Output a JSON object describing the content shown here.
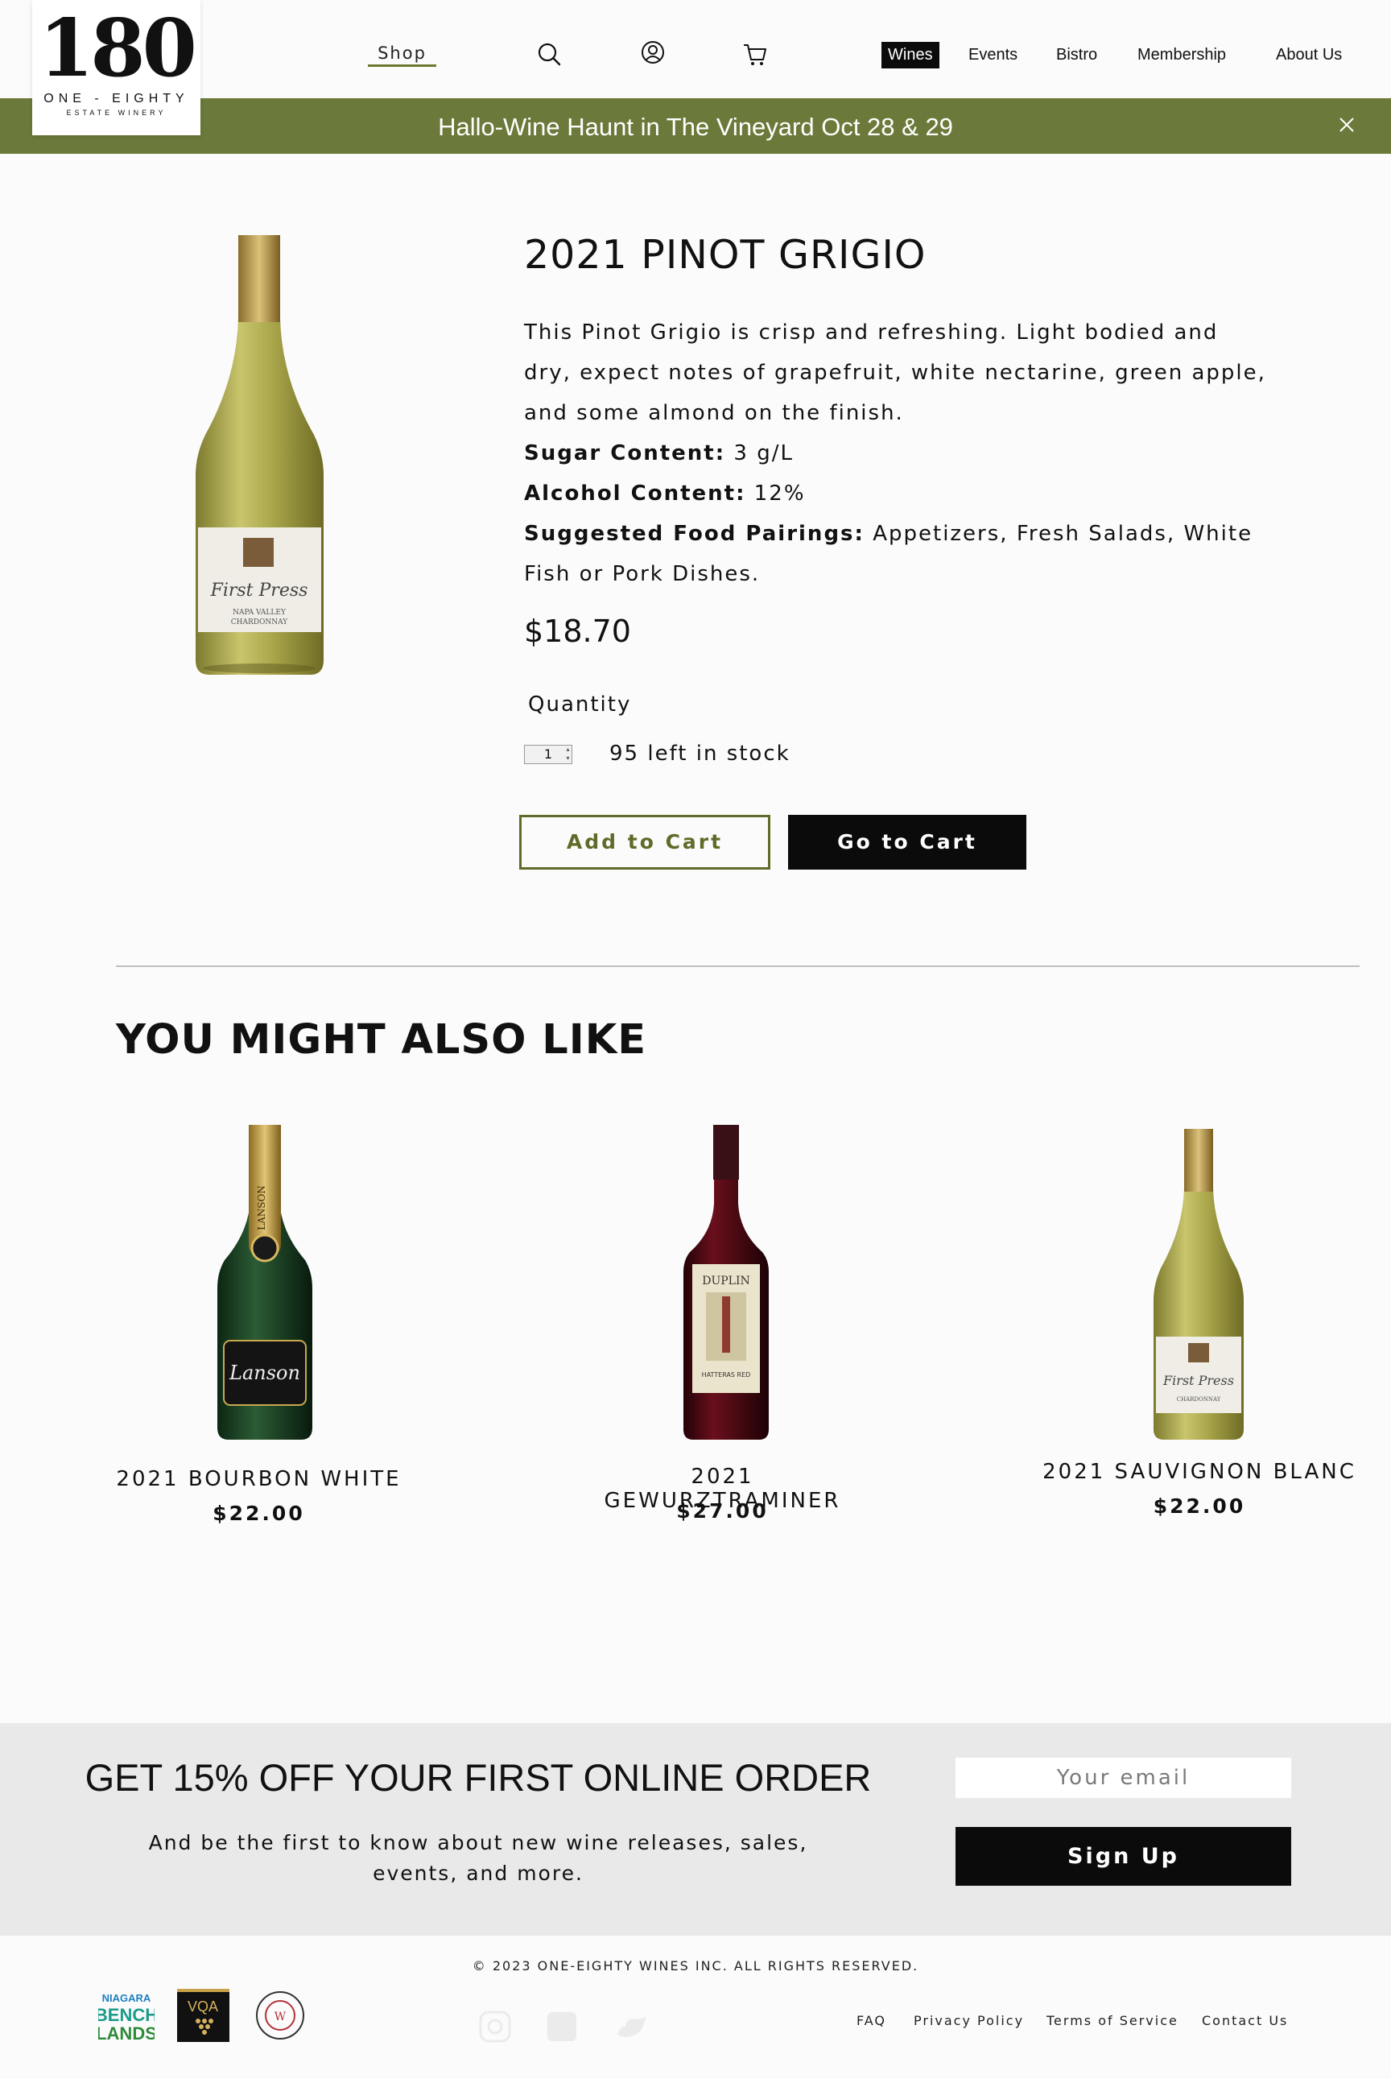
{
  "logo": {
    "number": "180",
    "name": "ONE - EIGHTY",
    "sub": "ESTATE WINERY"
  },
  "nav": {
    "shop": "Shop",
    "icons": [
      "search-icon",
      "account-icon",
      "cart-icon"
    ],
    "wines": "Wines",
    "events": "Events",
    "bistro": "Bistro",
    "membership": "Membership",
    "about": "About Us",
    "accent_color": "#6b7a2e"
  },
  "banner": {
    "text": "Hallo-Wine Haunt in The Vineyard Oct 28 & 29",
    "background": "#6b7a3a"
  },
  "product": {
    "title": "2021 PINOT GRIGIO",
    "description": "This Pinot Grigio is crisp and refreshing. Light bodied and dry, expect notes of grapefruit, white nectarine, green apple, and some almond on the finish.",
    "sugar_label": "Sugar Content:",
    "sugar_value": "3 g/L",
    "alcohol_label": "Alcohol Content:",
    "alcohol_value": "12%",
    "pairings_label": "Suggested Food Pairings:",
    "pairings_value": "Appetizers, Fresh Salads, White Fish or Pork Dishes.",
    "price": "$18.70",
    "quantity_label": "Quantity",
    "quantity_value": "1",
    "stock": "95 left in stock",
    "add_to_cart": "Add to Cart",
    "go_to_cart": "Go to Cart"
  },
  "recommendations": {
    "title": "YOU MIGHT ALSO LIKE",
    "items": [
      {
        "name": "2021 BOURBON WHITE",
        "price": "$22.00"
      },
      {
        "name": "2021 GEWURZTRAMINER",
        "price": "$27.00"
      },
      {
        "name": "2021 SAUVIGNON BLANC",
        "price": "$22.00"
      }
    ]
  },
  "newsletter": {
    "title": "GET 15% OFF YOUR FIRST ONLINE ORDER",
    "subtitle": "And be the first to know about new wine releases, sales, events, and more.",
    "email_placeholder": "Your email",
    "signup": "Sign Up"
  },
  "footer": {
    "copyright": "© 2023 ONE-EIGHTY WINES INC. ALL RIGHTS RESERVED.",
    "logos": [
      "NIAGARA BENCH LANDS",
      "VQA",
      "W"
    ],
    "links": [
      "FAQ",
      "Privacy Policy",
      "Terms of Service",
      "Contact Us"
    ]
  }
}
